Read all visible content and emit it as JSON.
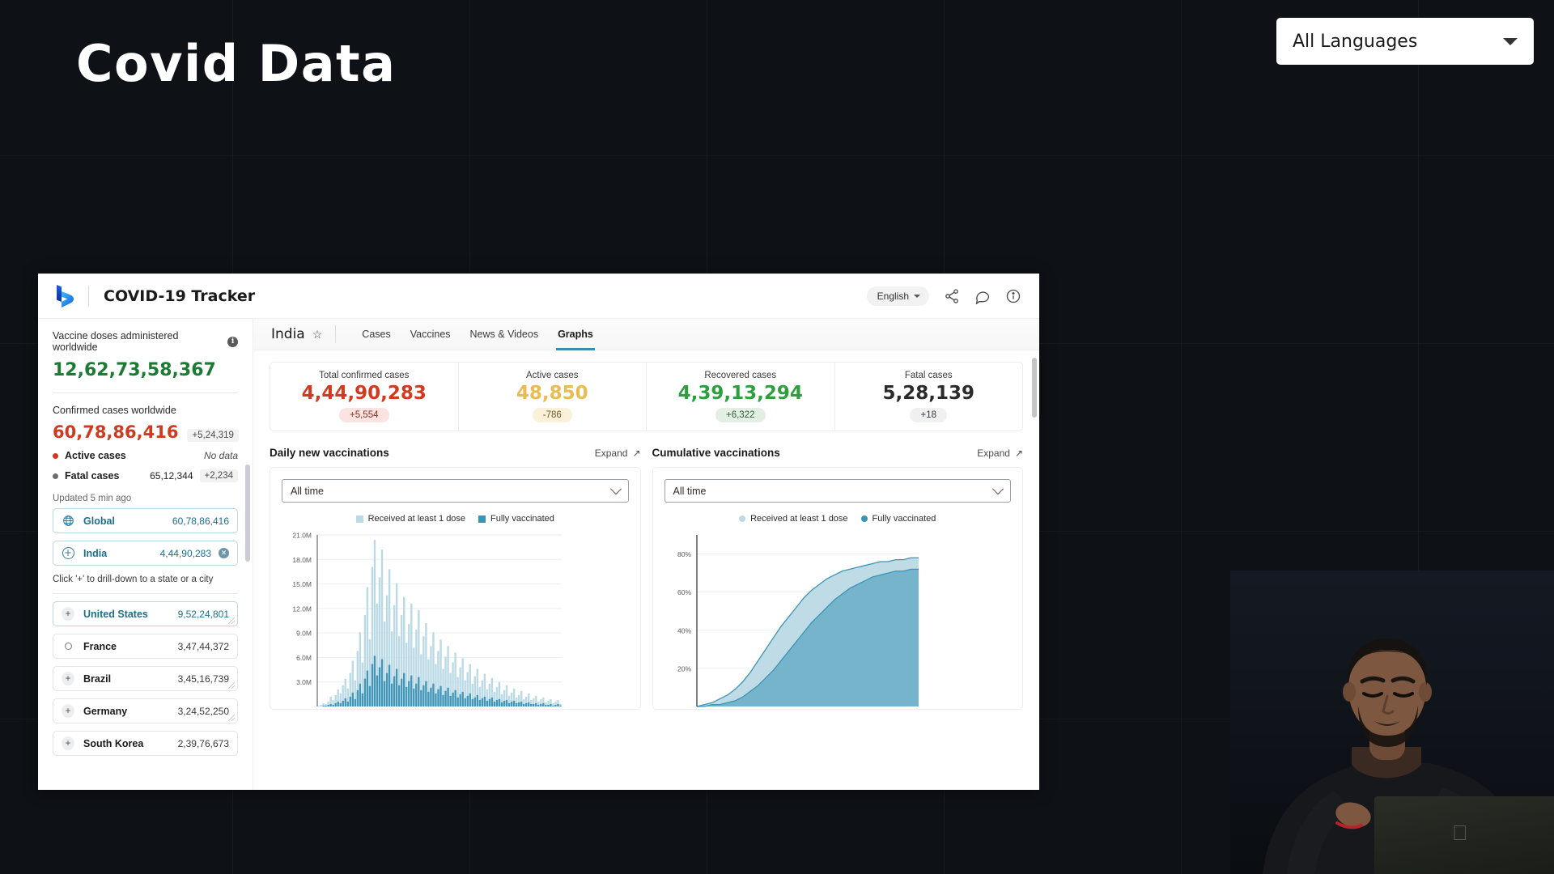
{
  "slide": {
    "title": "Covid Data",
    "language_selector": {
      "label": "All Languages",
      "icon": "chevron-down-icon"
    }
  },
  "app": {
    "logo_icon": "bing-logo-icon",
    "title": "COVID-19 Tracker",
    "header_language": "English",
    "header_icons": [
      "share-icon",
      "feedback-icon",
      "info-icon"
    ]
  },
  "sidebar": {
    "vaccine_label": "Vaccine doses administered worldwide",
    "vaccine_info_icon": "info-icon",
    "vaccine_value": "12,62,73,58,367",
    "confirmed_label": "Confirmed cases worldwide",
    "confirmed_value": "60,78,86,416",
    "confirmed_delta": "+5,24,319",
    "rows": [
      {
        "name": "Active cases",
        "value": "",
        "delta": "No data",
        "dot": "#d4351c"
      },
      {
        "name": "Fatal cases",
        "value": "65,12,344",
        "delta": "+2,234",
        "dot": "#6e6e6e"
      }
    ],
    "updated": "Updated 5 min ago",
    "selected_chips": [
      {
        "name": "Global",
        "value": "60,78,86,416",
        "icon": "globe-icon",
        "closable": false
      },
      {
        "name": "India",
        "value": "4,44,90,283",
        "icon": "plus-circle-icon",
        "closable": true,
        "close_icon": "close-icon"
      }
    ],
    "drill_hint": "Click '+' to drill-down to a state or a city",
    "countries": [
      {
        "name": "United States",
        "value": "9,52,24,801",
        "icon": "plus-icon",
        "highlight": true
      },
      {
        "name": "France",
        "value": "3,47,44,372",
        "icon": "circle-icon",
        "highlight": false
      },
      {
        "name": "Brazil",
        "value": "3,45,16,739",
        "icon": "plus-icon",
        "highlight": false
      },
      {
        "name": "Germany",
        "value": "3,24,52,250",
        "icon": "plus-icon",
        "highlight": false
      },
      {
        "name": "South Korea",
        "value": "2,39,76,673",
        "icon": "plus-icon",
        "highlight": false
      }
    ]
  },
  "main": {
    "country": "India",
    "favorite_icon": "star-icon",
    "tabs": [
      {
        "label": "Cases",
        "active": false
      },
      {
        "label": "Vaccines",
        "active": false
      },
      {
        "label": "News & Videos",
        "active": false
      },
      {
        "label": "Graphs",
        "active": true
      }
    ],
    "stats": [
      {
        "label": "Total confirmed cases",
        "value": "4,44,90,283",
        "delta": "+5,554",
        "color": "#cf3b20",
        "chip_bg": "#fae3e1",
        "chip_fg": "#8a3022"
      },
      {
        "label": "Active cases",
        "value": "48,850",
        "delta": "-786",
        "color": "#e8bb55",
        "chip_bg": "#fbf0d8",
        "chip_fg": "#6d5a28"
      },
      {
        "label": "Recovered cases",
        "value": "4,39,13,294",
        "delta": "+6,322",
        "color": "#2f9e3f",
        "chip_bg": "#e3efe4",
        "chip_fg": "#2c6133"
      },
      {
        "label": "Fatal cases",
        "value": "5,28,139",
        "delta": "+18",
        "color": "#2b2b2b",
        "chip_bg": "#eff0f1",
        "chip_fg": "#3a3a3a"
      }
    ]
  },
  "chart_data": [
    {
      "type": "bar",
      "title": "Daily new vaccinations",
      "expand_label": "Expand",
      "expand_icon": "expand-arrow-icon",
      "range_select": {
        "value": "All time",
        "icon": "chevron-down-icon"
      },
      "legend": [
        {
          "name": "Received at least 1 dose",
          "color": "#bcdae5"
        },
        {
          "name": "Fully vaccinated",
          "color": "#3b94b5"
        }
      ],
      "ylabel": "",
      "xlabel": "",
      "ylim": [
        0,
        21000000
      ],
      "yticks": [
        "3.0M",
        "6.0M",
        "9.0M",
        "12.0M",
        "15.0M",
        "18.0M",
        "21.0M"
      ],
      "ytick_values": [
        3000000,
        6000000,
        9000000,
        12000000,
        15000000,
        18000000,
        21000000
      ],
      "grid": true,
      "series": [
        {
          "name": "Received at least 1 dose",
          "color": "#bcdae5",
          "values": [
            0.1,
            0.2,
            0.4,
            0.3,
            0.6,
            1.2,
            0.8,
            1.4,
            2.1,
            1.6,
            2.6,
            3.4,
            2.2,
            4.1,
            5.6,
            3.2,
            6.8,
            9.1,
            5.4,
            11.2,
            14.6,
            8.2,
            17.1,
            20.4,
            12.6,
            15.8,
            19.2,
            10.4,
            13.6,
            16.8,
            9.2,
            12.4,
            15.1,
            8.6,
            11.2,
            13.4,
            7.8,
            10.1,
            12.6,
            7.2,
            9.4,
            11.8,
            6.4,
            8.6,
            10.2,
            5.8,
            7.4,
            9.1,
            5.2,
            6.8,
            8.2,
            4.6,
            6.1,
            7.4,
            4.1,
            5.4,
            6.6,
            3.6,
            4.8,
            5.9,
            3.2,
            4.2,
            5.2,
            2.8,
            3.7,
            4.6,
            2.4,
            3.2,
            4.0,
            2.1,
            2.8,
            3.5,
            1.8,
            2.4,
            3.0,
            1.5,
            2.0,
            2.6,
            1.3,
            1.7,
            2.2,
            1.1,
            1.4,
            1.9,
            0.9,
            1.2,
            1.6,
            0.8,
            1.0,
            1.3,
            0.6,
            0.9,
            1.1,
            0.5,
            0.7,
            0.9,
            0.4,
            0.6,
            0.8,
            0.3
          ]
        },
        {
          "name": "Fully vaccinated",
          "color": "#3b94b5",
          "values": [
            0.0,
            0.0,
            0.1,
            0.1,
            0.2,
            0.3,
            0.2,
            0.4,
            0.6,
            0.4,
            0.7,
            1.0,
            0.6,
            1.2,
            1.7,
            0.9,
            2.0,
            2.8,
            1.6,
            3.4,
            4.4,
            2.5,
            5.2,
            6.2,
            3.8,
            4.8,
            5.8,
            3.1,
            4.1,
            5.1,
            2.8,
            3.7,
            4.6,
            2.6,
            3.4,
            4.1,
            2.4,
            3.1,
            3.8,
            2.2,
            2.8,
            3.6,
            2.0,
            2.6,
            3.1,
            1.8,
            2.3,
            2.8,
            1.6,
            2.1,
            2.5,
            1.4,
            1.9,
            2.3,
            1.3,
            1.7,
            2.0,
            1.1,
            1.5,
            1.8,
            1.0,
            1.3,
            1.6,
            0.9,
            1.1,
            1.4,
            0.8,
            1.0,
            1.2,
            0.7,
            0.9,
            1.1,
            0.6,
            0.8,
            0.9,
            0.5,
            0.7,
            0.8,
            0.4,
            0.6,
            0.7,
            0.4,
            0.5,
            0.6,
            0.3,
            0.4,
            0.5,
            0.3,
            0.3,
            0.4,
            0.2,
            0.3,
            0.4,
            0.2,
            0.2,
            0.3,
            0.1,
            0.2,
            0.3,
            0.1
          ]
        }
      ]
    },
    {
      "type": "area",
      "title": "Cumulative vaccinations",
      "expand_label": "Expand",
      "expand_icon": "expand-arrow-icon",
      "range_select": {
        "value": "All time",
        "icon": "chevron-down-icon"
      },
      "legend": [
        {
          "name": "Received at least 1 dose",
          "color": "#bcdae5"
        },
        {
          "name": "Fully vaccinated",
          "color": "#3b94b5"
        }
      ],
      "ylabel": "",
      "xlabel": "",
      "ylim": [
        0,
        90
      ],
      "yticks": [
        "20%",
        "40%",
        "60%",
        "80%"
      ],
      "ytick_values": [
        20,
        40,
        60,
        80
      ],
      "grid": true,
      "series": [
        {
          "name": "Received at least 1 dose",
          "color": "#bcdae5",
          "values": [
            0,
            1,
            2,
            4,
            6,
            9,
            13,
            18,
            24,
            30,
            36,
            42,
            47,
            52,
            57,
            61,
            64,
            67,
            69,
            71,
            72,
            73,
            74,
            75,
            76,
            76,
            77,
            77,
            78,
            78
          ]
        },
        {
          "name": "Fully vaccinated",
          "color": "#3b94b5",
          "values": [
            0,
            0,
            1,
            1,
            2,
            3,
            5,
            8,
            11,
            15,
            19,
            24,
            29,
            34,
            39,
            44,
            48,
            52,
            56,
            59,
            62,
            64,
            66,
            68,
            69,
            70,
            71,
            71,
            72,
            72
          ]
        }
      ]
    }
  ]
}
